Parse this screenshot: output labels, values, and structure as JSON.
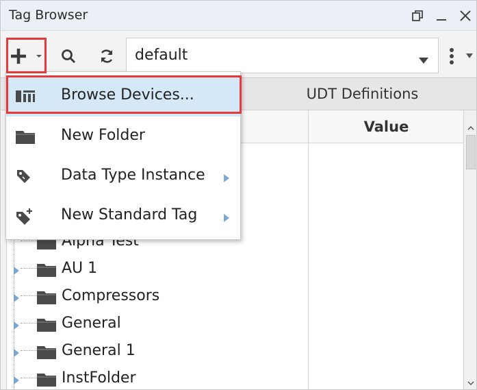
{
  "window": {
    "title": "Tag Browser",
    "icons": [
      "restore-icon",
      "minimize-icon",
      "close-icon"
    ]
  },
  "toolbar": {
    "provider": {
      "value": "default"
    }
  },
  "tabs": [
    {
      "label": "UDT Definitions"
    }
  ],
  "table": {
    "columns": {
      "value": "Value"
    },
    "rows": [
      {
        "label": "Alpha Test"
      },
      {
        "label": "AU 1"
      },
      {
        "label": "Compressors"
      },
      {
        "label": "General"
      },
      {
        "label": "General 1"
      },
      {
        "label": "InstFolder"
      }
    ]
  },
  "menu": {
    "items": [
      {
        "label": "Browse Devices...",
        "icon": "browse-devices-icon",
        "submenu": false,
        "highlighted": true
      },
      {
        "label": "New Folder",
        "icon": "folder-icon",
        "submenu": false
      },
      {
        "label": "Data Type Instance",
        "icon": "tag-icon",
        "submenu": true
      },
      {
        "label": "New Standard Tag",
        "icon": "tag-plus-icon",
        "submenu": true
      }
    ]
  },
  "colors": {
    "highlight": "#d5e8f7",
    "annotation": "#e5393c",
    "titlebar": "#ebf0f6"
  }
}
